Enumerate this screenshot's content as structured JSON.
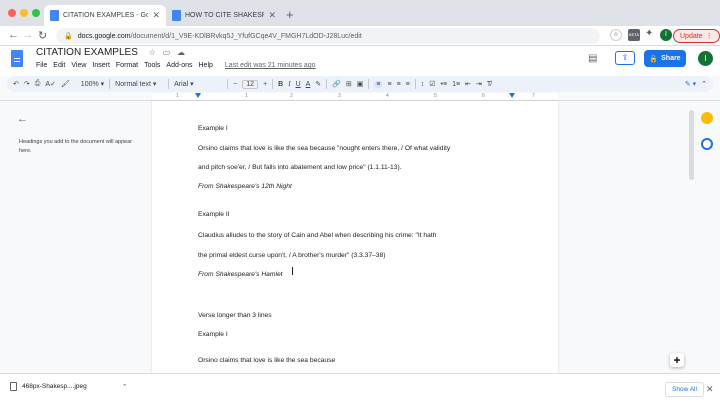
{
  "browser": {
    "tabs": [
      {
        "label": "CITATION EXAMPLES - Google",
        "active": true
      },
      {
        "label": "HOW TO CITE SHAKESPEARE",
        "active": false
      }
    ],
    "url_host": "docs.google.com",
    "url_path": "/document/d/1_V9E-KDlBRvkq5J_YfufGCqe4V_FMGH7LdOD-J28Luc/edit",
    "update_label": "Update",
    "profile_initial": "I",
    "beta_badge": "BETA"
  },
  "docs": {
    "title": "CITATION EXAMPLES",
    "menu": [
      "File",
      "Edit",
      "View",
      "Insert",
      "Format",
      "Tools",
      "Add-ons",
      "Help"
    ],
    "last_edit": "Last edit was 21 minutes ago",
    "share_label": "Share",
    "avatar_initial": "I"
  },
  "toolbar": {
    "zoom": "100%",
    "style": "Normal text",
    "font": "Arial",
    "font_size": "12",
    "bold": "B",
    "italic": "I",
    "underline": "U",
    "text_color": "A"
  },
  "ruler": {
    "numbers": [
      "1",
      "1",
      "2",
      "3",
      "4",
      "5",
      "6",
      "7"
    ]
  },
  "outline": {
    "hint": "Headings you add to the document will appear here."
  },
  "document": {
    "paragraphs": [
      {
        "text": "Example I",
        "italic": false
      },
      {
        "text": "Orsino claims that love is like the sea because \"nought enters there, / Of what validity",
        "italic": false
      },
      {
        "text": "and pitch soe'er, / But falls into abatement and low price\" (1.1.11-13).",
        "italic": false
      },
      {
        "text": "From Shakespeare's 12th Night",
        "italic": true
      },
      {
        "text": "Example II",
        "italic": false
      },
      {
        "text": "Claudius alludes to the story of Cain and Abel when describing his crime: \"It hath",
        "italic": false
      },
      {
        "text": "the primal eldest curse upon't, / A brother's murder\" (3.3.37–38)",
        "italic": false
      },
      {
        "text": "From Shakespeare's Hamlet",
        "italic": true
      },
      {
        "text": "Verse longer than 3 lines",
        "italic": false
      },
      {
        "text": "Example I",
        "italic": false
      },
      {
        "text": "Orsino claims that love is like the sea because",
        "italic": false
      }
    ]
  },
  "downloads": {
    "file_name": "468px-Shakesp....jpeg",
    "show_all_label": "Show All"
  },
  "colors": {
    "accent": "#1a73e8",
    "update": "#d93025",
    "avatar": "#137333"
  }
}
